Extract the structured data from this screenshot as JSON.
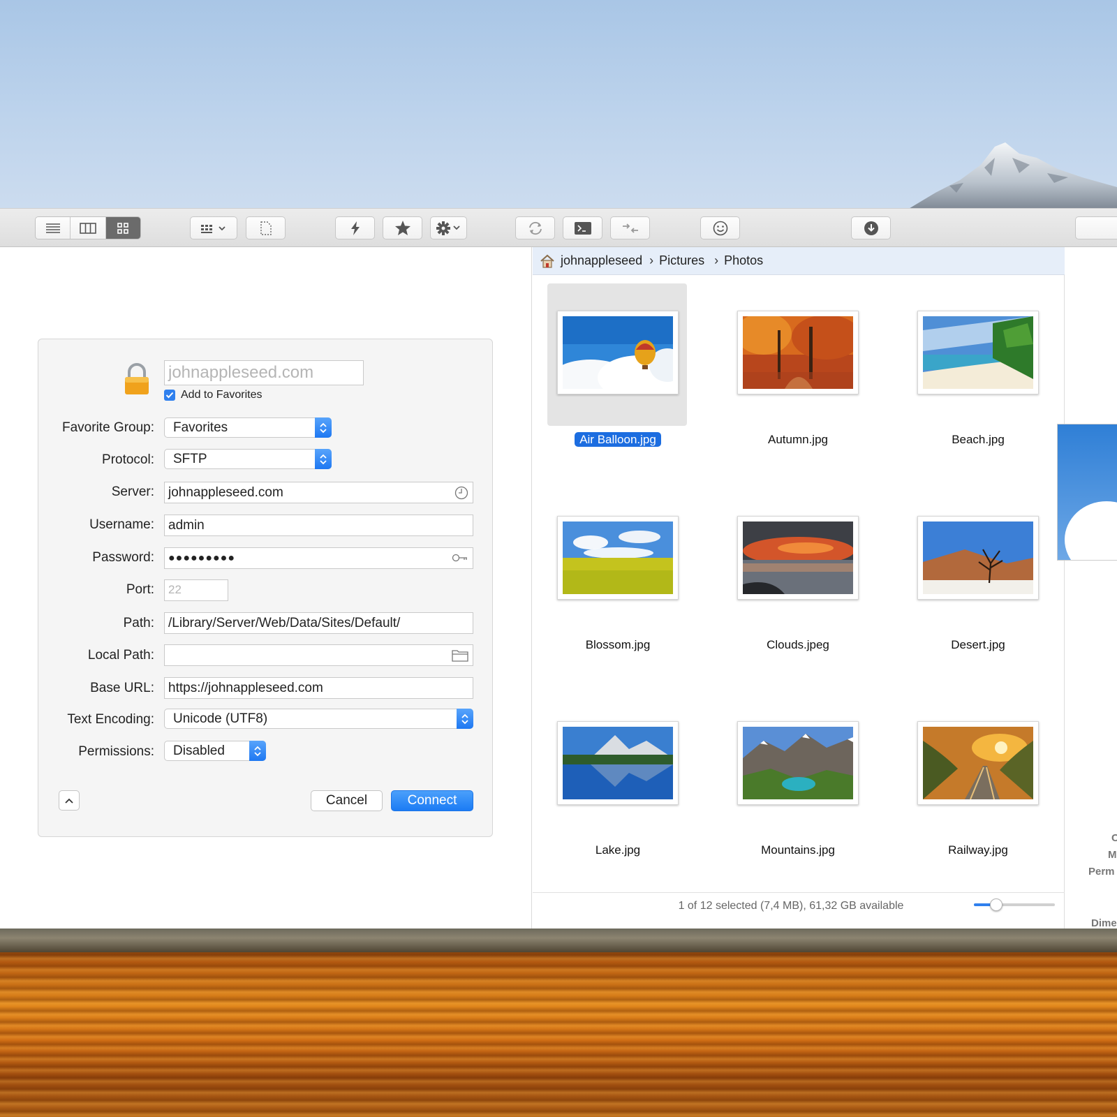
{
  "toolbar": {
    "view_modes": [
      "list-view-icon",
      "column-view-icon",
      "icon-view-icon"
    ],
    "active_view": "icon-view-icon"
  },
  "dialog": {
    "name_placeholder": "johnappleseed.com",
    "add_to_favorites": "Add to Favorites",
    "add_to_favorites_checked": true,
    "labels": {
      "favorite_group": "Favorite Group:",
      "protocol": "Protocol:",
      "server": "Server:",
      "username": "Username:",
      "password": "Password:",
      "port": "Port:",
      "path": "Path:",
      "local_path": "Local Path:",
      "base_url": "Base URL:",
      "text_encoding": "Text Encoding:",
      "permissions": "Permissions:"
    },
    "values": {
      "favorite_group": "Favorites",
      "protocol": "SFTP",
      "server": "johnappleseed.com",
      "username": "admin",
      "password": "●●●●●●●●●",
      "port": "22",
      "path": "/Library/Server/Web/Data/Sites/Default/",
      "local_path": "",
      "base_url": "https://johnappleseed.com",
      "text_encoding": "Unicode (UTF8)",
      "permissions": "Disabled"
    },
    "cancel": "Cancel",
    "connect": "Connect"
  },
  "browser": {
    "breadcrumb": [
      "johnappleseed",
      "Pictures",
      "Photos"
    ],
    "files": [
      {
        "name": "Air Balloon.jpg",
        "selected": true
      },
      {
        "name": "Autumn.jpg",
        "selected": false
      },
      {
        "name": "Beach.jpg",
        "selected": false
      },
      {
        "name": "Blossom.jpg",
        "selected": false
      },
      {
        "name": "Clouds.jpeg",
        "selected": false
      },
      {
        "name": "Desert.jpg",
        "selected": false
      },
      {
        "name": "Lake.jpg",
        "selected": false
      },
      {
        "name": "Mountains.jpg",
        "selected": false
      },
      {
        "name": "Railway.jpg",
        "selected": false
      }
    ],
    "status": "1 of 12 selected (7,4 MB), 61,32 GB available",
    "zoom_level": 0.28
  },
  "inspector": {
    "partial_labels": [
      "C",
      "M",
      "Perm",
      "Dime"
    ]
  },
  "colors": {
    "accent": "#1c6de0",
    "connect_button": "#1b7bf4",
    "lock": "#f0a21c"
  }
}
